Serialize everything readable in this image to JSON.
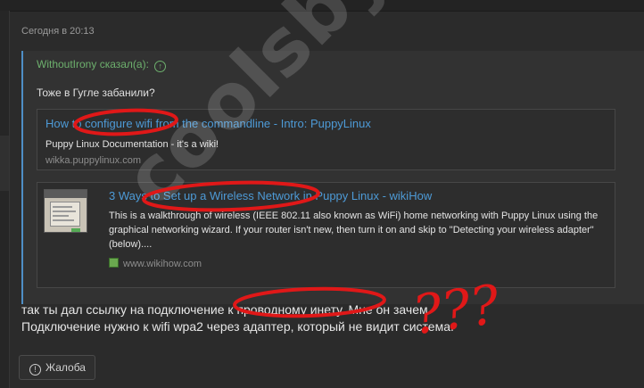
{
  "post": {
    "timestamp": "Сегодня в 20:13",
    "quote": {
      "author": "WithoutIrony сказал(а):",
      "arrow_icon": "arrow-up-circle-icon",
      "text": "Тоже в Гугле забанили?",
      "links": [
        {
          "title": "How to configure wifi from the commandline - Intro: PuppyLinux",
          "description": "Puppy Linux Documentation - it's a wiki!",
          "domain": "wikka.puppylinux.com"
        },
        {
          "title": "3 Ways to Set up a Wireless Network in Puppy Linux - wikiHow",
          "description": "This is a walkthrough of wireless (IEEE 802.11 also known as WiFi) home networking with Puppy Linux using the graphical networking wizard. If your router isn't new, then turn it on and skip to \"Detecting your wireless adapter\" (below)....",
          "domain": "www.wikihow.com",
          "thumbnail_icon": "wikihow-thumbnail",
          "favicon": "wikihow-favicon"
        }
      ]
    },
    "reply_lines": [
      "так ты дал ссылку на подключение к проводному инету. Мне он зачем.",
      "Подключение нужно к wifi wpa2 через адаптер, который не видит система."
    ],
    "report_button": "Жалоба"
  },
  "watermark": "coolsby.net",
  "annotation_text": "???",
  "colors": {
    "background": "#2b2b2b",
    "link": "#4d9ad6",
    "author": "#6db06d",
    "quote_border": "#4f8fc6",
    "annotation": "#e01818"
  }
}
